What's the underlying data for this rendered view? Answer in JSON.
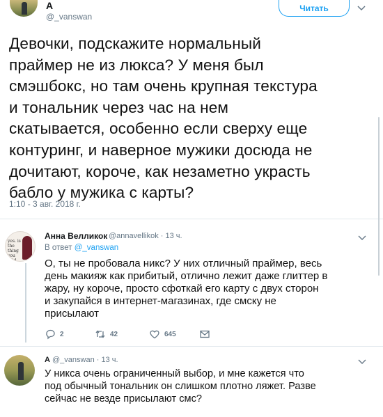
{
  "main_tweet": {
    "author_name": "A",
    "author_handle": "@_vanswan",
    "follow_label": "Читать",
    "lines": [
      "Девочки, подскажите нормальный",
      "праймер не из люкса? У меня был",
      "смэшбокс,  но там очень крупная текстура",
      "и тональник через час на нем",
      "скатывается,  особенно если сверху еще",
      "контуринг, и наверное мужики досюда не",
      "дочитают, короче, как незаметно украсть",
      "бабло у мужика с карты?"
    ],
    "date": "1:10 - 3 авг. 2018 г."
  },
  "reply1": {
    "author_name": "Анна Велликок",
    "meta": "@annavellikok · 13 ч.",
    "reply_prefix": "В ответ ",
    "reply_to": "@_vanswan",
    "avatar_text": "yes. is the thing you said",
    "lines": [
      "О, ты не пробовала никс? У них отличный праймер, весь",
      "день макияж как прибитый, отлично лежит даже глиттер в",
      "жару, ну короче, просто сфоткай его карту с двух сторон",
      "и закупайся в интернет-магазинах, где смску не",
      "присылают"
    ],
    "actions": {
      "replies": "2",
      "retweets": "42",
      "likes": "645"
    }
  },
  "reply2": {
    "author_name": "A",
    "meta": " @_vanswan · 13 ч.",
    "lines": [
      "У никса очень ограниченный выбор, и мне кажется что",
      "под обычный тональник он слишком плотно ляжет. Разве",
      "сейчас не везде присылают смс?"
    ]
  },
  "colors": {
    "accent": "#1da1f2",
    "muted": "#657786",
    "text": "#14171a",
    "divider": "#e1e8ed"
  }
}
